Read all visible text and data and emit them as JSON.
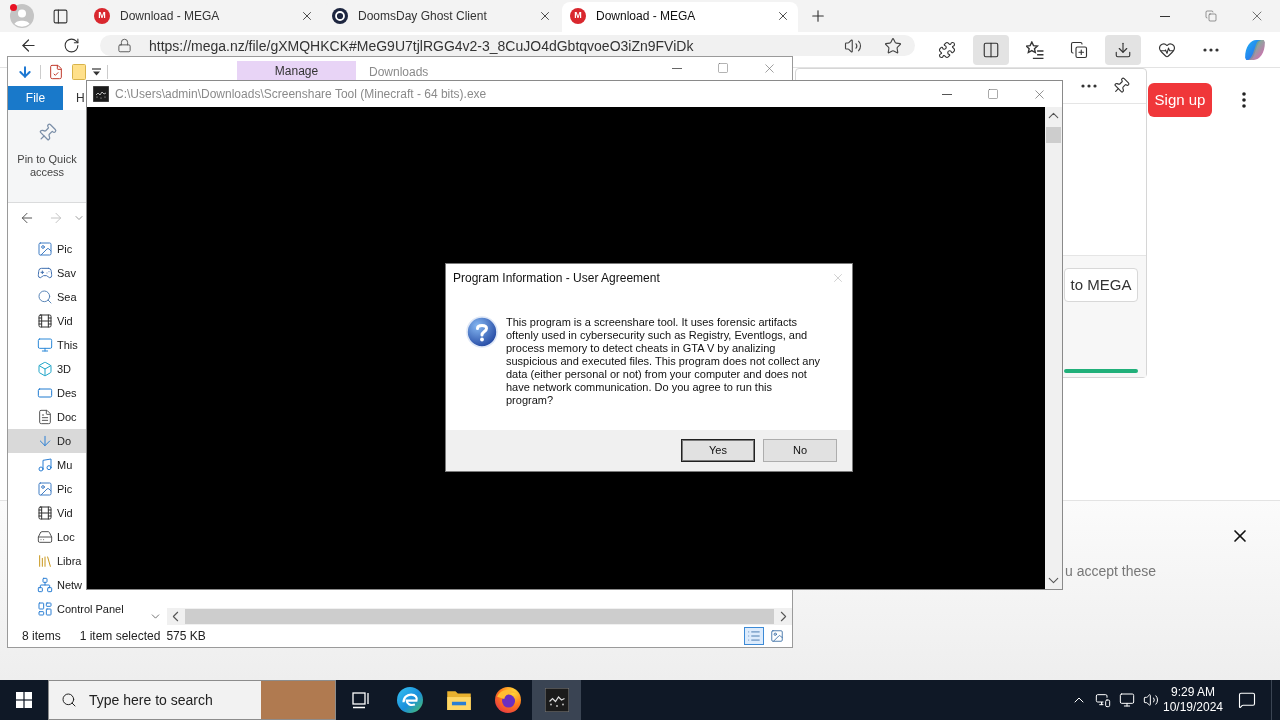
{
  "browser": {
    "tabs": [
      {
        "icon": {
          "kind": "mega",
          "logo": "M"
        },
        "title": "Download - MEGA",
        "selected": false
      },
      {
        "icon": {
          "kind": "ring"
        },
        "title": "DoomsDay Ghost Client",
        "selected": false
      },
      {
        "icon": {
          "kind": "mega",
          "logo": "M"
        },
        "title": "Download - MEGA",
        "selected": true
      }
    ],
    "url": "https://mega.nz/file/gXMQHKCK#MeG9U7tjlRGG4v2-3_8CuJO4dGbtqvoeO3iZn9FViDk",
    "toolbar": [
      {
        "kind": "extensions",
        "selected": false
      },
      {
        "kind": "split-screen",
        "selected": true
      },
      {
        "kind": "favorites",
        "selected": false
      },
      {
        "kind": "collections",
        "selected": false
      },
      {
        "kind": "downloads",
        "selected": true
      },
      {
        "kind": "essentials",
        "selected": false
      },
      {
        "kind": "more",
        "selected": false
      },
      {
        "kind": "copilot",
        "selected": false
      }
    ],
    "downloads_panel": {
      "button": "to MEGA"
    },
    "page": {
      "sign_up": "Sign up",
      "banner_text": "u accept these"
    }
  },
  "explorer": {
    "contextual_tab": "Manage",
    "title": "Downloads",
    "ribbon_tabs": [
      {
        "kind": "file",
        "label": "File"
      },
      {
        "kind": "tab",
        "label": "H"
      }
    ],
    "ribbon_command": "Pin to Quick access",
    "nav_tree": [
      {
        "children": [
          {
            "kind": "pictures",
            "label": "Pic",
            "selected": false
          },
          {
            "kind": "saved-games",
            "label": "Sav",
            "selected": false
          },
          {
            "kind": "searches",
            "label": "Sea",
            "selected": false
          },
          {
            "kind": "videos",
            "label": "Vid",
            "selected": false
          }
        ]
      },
      {
        "kind": "this-pc",
        "label": "This",
        "selected": false,
        "children": [
          {
            "kind": "objects",
            "label": "3D",
            "selected": false
          },
          {
            "kind": "desktop",
            "label": "Des",
            "selected": false
          },
          {
            "kind": "documents",
            "label": "Doc",
            "selected": false
          },
          {
            "kind": "downloads",
            "label": "Do",
            "selected": true
          },
          {
            "kind": "music",
            "label": "Mu",
            "selected": false
          },
          {
            "kind": "pictures",
            "label": "Pic",
            "selected": false
          },
          {
            "kind": "videos",
            "label": "Vid",
            "selected": false
          },
          {
            "kind": "local-disk",
            "label": "Loc",
            "selected": false
          }
        ]
      },
      {
        "kind": "libraries",
        "label": "Libra",
        "selected": false
      },
      {
        "kind": "network",
        "label": "Netw",
        "selected": false
      },
      {
        "kind": "control-panel",
        "label": "Control Panel",
        "selected": false
      }
    ],
    "status": {
      "count": "8 items",
      "selection": "1 item selected",
      "size": "575 KB"
    },
    "views": [
      {
        "kind": "details",
        "selected": true
      },
      {
        "kind": "large-icons",
        "selected": false
      }
    ]
  },
  "console": {
    "title": "C:\\Users\\admin\\Downloads\\Screenshare Tool (Minecraft - 64 bits).exe"
  },
  "dialog": {
    "title": "Program Information - User Agreement",
    "message": "This program is a screenshare tool. It uses forensic artifacts oftenly used in cybersecurity such as Registry, Eventlogs, and process memory to detect cheats in GTA V by analizing suspicious and executed files. This program does not collect any data (either personal or not) from your computer and does not have network communication. Do you agree to run this program?",
    "buttons": [
      {
        "label": "Yes",
        "default": true
      },
      {
        "label": "No",
        "default": false
      }
    ]
  },
  "taskbar": {
    "search_placeholder": "Type here to search",
    "apps": [
      {
        "kind": "task-view",
        "selected": false
      },
      {
        "kind": "edge",
        "selected": false
      },
      {
        "kind": "file-explorer",
        "selected": false
      },
      {
        "kind": "firefox",
        "selected": false
      },
      {
        "kind": "console",
        "selected": true
      }
    ],
    "time": "9:29 AM",
    "date": "10/19/2024"
  }
}
